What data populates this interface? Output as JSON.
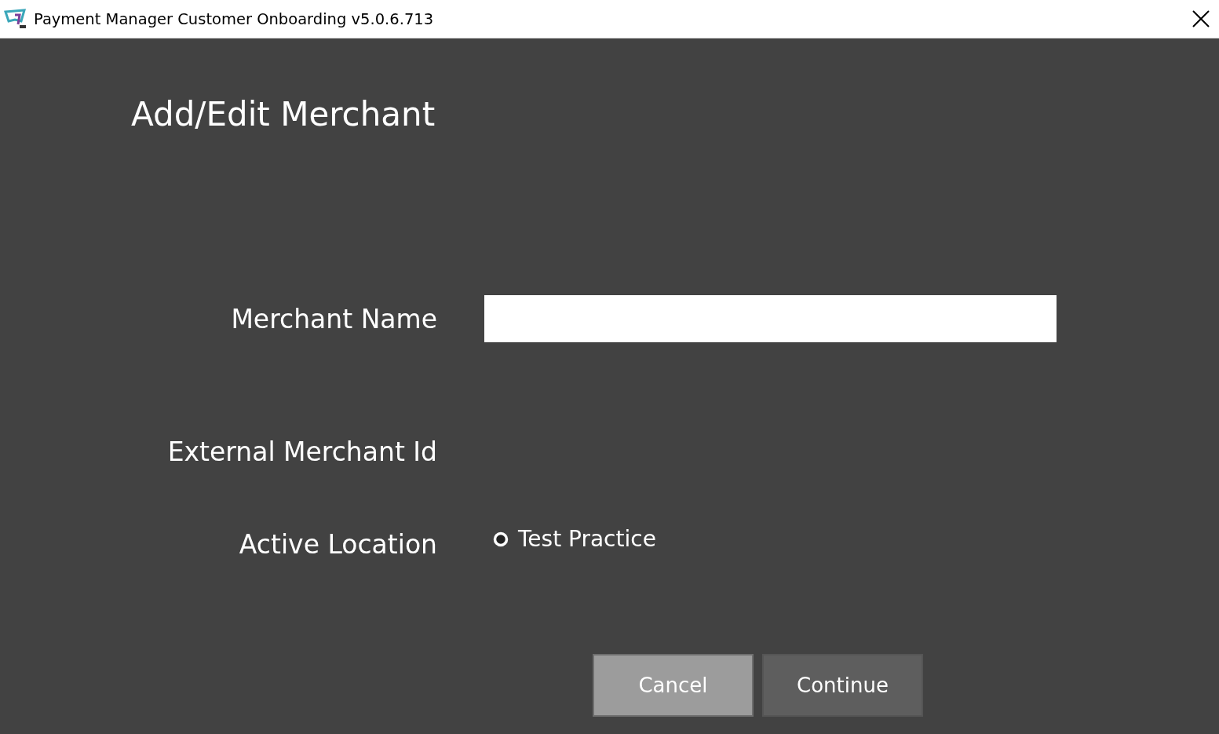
{
  "window": {
    "title": "Payment Manager Customer Onboarding v5.0.6.713"
  },
  "heading": "Add/Edit Merchant",
  "form": {
    "merchant_name": {
      "label": "Merchant Name"
    },
    "external_merchant_id": {
      "label": "External Merchant Id"
    },
    "active_location": {
      "label": "Active Location",
      "options": [
        {
          "label": "Test Practice",
          "selected": false
        }
      ]
    }
  },
  "buttons": [
    {
      "label": "Cancel",
      "hovered": true
    },
    {
      "label": "Continue",
      "hovered": false
    }
  ]
}
